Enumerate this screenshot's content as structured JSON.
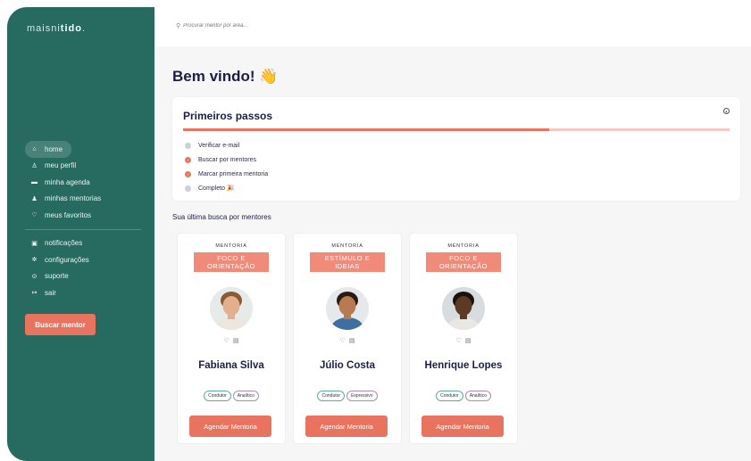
{
  "app": {
    "logo_prefix": "maisni",
    "logo_bold": "tido",
    "logo_suffix": "."
  },
  "search": {
    "placeholder": "Procurar mentor por área..."
  },
  "sidebar": {
    "items": [
      {
        "label": "home",
        "icon": "home-icon",
        "glyph": "⌂",
        "active": true
      },
      {
        "label": "meu perfil",
        "icon": "user-icon",
        "glyph": "♙"
      },
      {
        "label": "minha agenda",
        "icon": "calendar-icon",
        "glyph": "▬"
      },
      {
        "label": "minhas mentorias",
        "icon": "users-icon",
        "glyph": "♟"
      },
      {
        "label": "meus favoritos",
        "icon": "heart-icon",
        "glyph": "♡"
      },
      {
        "label": "notificações",
        "icon": "bell-icon",
        "glyph": "▣"
      },
      {
        "label": "configurações",
        "icon": "gear-icon",
        "glyph": "✲"
      },
      {
        "label": "suporte",
        "icon": "help-icon",
        "glyph": "⊙"
      },
      {
        "label": "sair",
        "icon": "logout-icon",
        "glyph": "↦"
      }
    ],
    "cta": "Buscar mentor"
  },
  "welcome": "Bem vindo! 👋",
  "steps": {
    "title": "Primeiros passos",
    "progress_percent": 67,
    "items": [
      {
        "label": "Verificar e-mail",
        "done": false
      },
      {
        "label": "Buscar por mentores",
        "done": true
      },
      {
        "label": "Marcar primeira mentoria",
        "done": true
      },
      {
        "label": "Completo 🎉",
        "done": false
      }
    ]
  },
  "recent_search": {
    "title": "Sua última busca por mentores",
    "mentors": [
      {
        "kicker": "MENTORIA",
        "tag_line1": "FOCO E",
        "tag_line2": "ORIENTAÇÃO",
        "name": "Fabiana Silva",
        "chips": [
          "Condutor",
          "Analítico"
        ],
        "cta": "Agendar Mentoria",
        "skin": "#e2b08f",
        "hair": "#8a5a34",
        "shirt": "#ece6df",
        "bg": "#e6ebe9"
      },
      {
        "kicker": "MENTORIA",
        "tag_line1": "ESTÍMULO E",
        "tag_line2": "IDEIAS",
        "name": "Júlio Costa",
        "chips": [
          "Condutor",
          "Expressivo"
        ],
        "cta": "Agendar Mentoria",
        "skin": "#b77a53",
        "hair": "#2a1b12",
        "shirt": "#3f6fa0",
        "bg": "#e5e9ec"
      },
      {
        "kicker": "MENTORIA",
        "tag_line1": "FOCO E",
        "tag_line2": "ORIENTAÇÃO",
        "name": "Henrique Lopes",
        "chips": [
          "Condutor",
          "Analítico"
        ],
        "cta": "Agendar Mentoria",
        "skin": "#5d3a26",
        "hair": "#1b120c",
        "shirt": "#e9e7e4",
        "bg": "#d9dcde"
      }
    ]
  },
  "colors": {
    "sidebar": "#266a60",
    "accent": "#e8735f",
    "heading": "#1b1f45"
  }
}
